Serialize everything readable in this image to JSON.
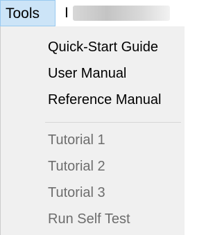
{
  "menubar": {
    "tools_label": "Tools",
    "help_label": "I"
  },
  "menu": {
    "group1": [
      {
        "label": "Quick-Start Guide",
        "enabled": true
      },
      {
        "label": "User Manual",
        "enabled": true
      },
      {
        "label": "Reference Manual",
        "enabled": true
      }
    ],
    "group2": [
      {
        "label": "Tutorial 1",
        "enabled": false
      },
      {
        "label": "Tutorial 2",
        "enabled": false
      },
      {
        "label": "Tutorial 3",
        "enabled": false
      },
      {
        "label": "Run Self Test",
        "enabled": false
      }
    ]
  },
  "colors": {
    "menubar_highlight": "#cce4f7",
    "menu_background": "#f0f0f0",
    "disabled_text": "#6d6d6d"
  }
}
